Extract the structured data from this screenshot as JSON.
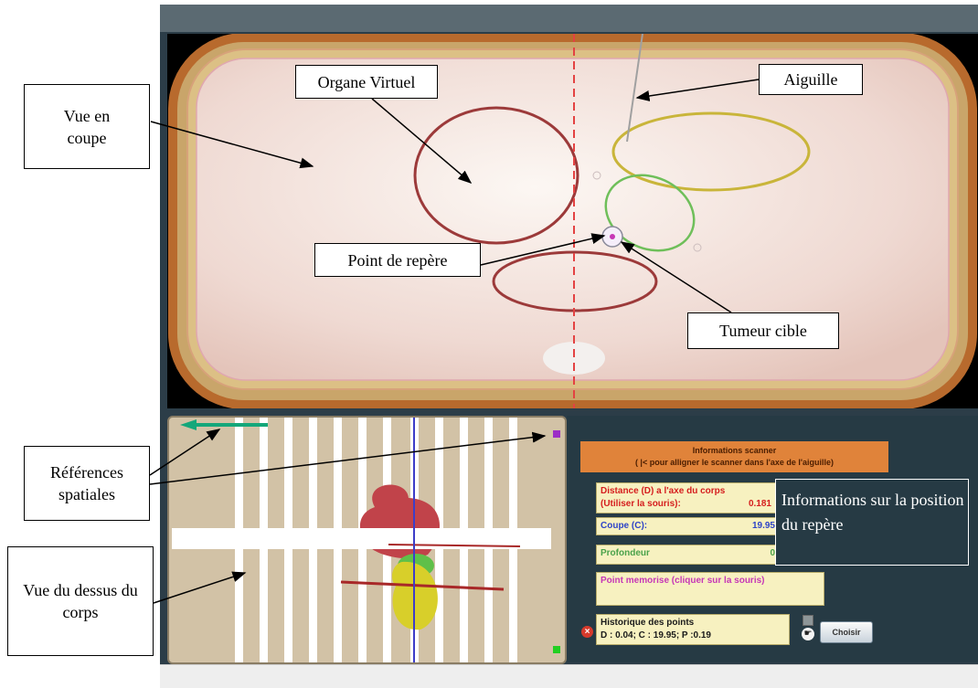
{
  "annotations": {
    "vue_en_coupe": "Vue en coupe",
    "organe_virtuel": "Organe Virtuel",
    "aiguille": "Aiguille",
    "point_de_repere": "Point de repère",
    "tumeur_cible": "Tumeur cible",
    "references_spatiales": "Références spatiales",
    "vue_du_dessus": "Vue du dessus du corps",
    "informations_position": "Informations sur la position du repère"
  },
  "scanner_info": {
    "header_title": "Informations scanner",
    "header_subtitle": "( |< pour alligner le scanner dans l'axe de l'aiguille)",
    "distance_label_1": "Distance  (D) a l'axe du corps",
    "distance_label_2": "(Utiliser la souris):",
    "distance_value": "0.181",
    "coupe_label": "Coupe (C):",
    "coupe_value": "19.95",
    "profondeur_label": "Profondeur",
    "profondeur_value": "0",
    "point_memorise_label": "Point memorise (cliquer sur la souris)",
    "historique_label": "Historique des points",
    "historique_value": "D : 0.04; C : 19.95; P :0.19",
    "choose_button_label": "Choisir"
  },
  "icons": {
    "delete": "close-icon",
    "stop": "stop-icon",
    "hand": "hand-pointer-icon"
  },
  "colors": {
    "panel_bg": "#263a44",
    "header_orange": "#e0833a",
    "field_yellow": "#f7f1c0",
    "organ_red": "#9c3a3a",
    "needle_gray": "#a0a0a0",
    "tumor_green": "#6fbf5a",
    "organ_yellow": "#c9b53a"
  }
}
